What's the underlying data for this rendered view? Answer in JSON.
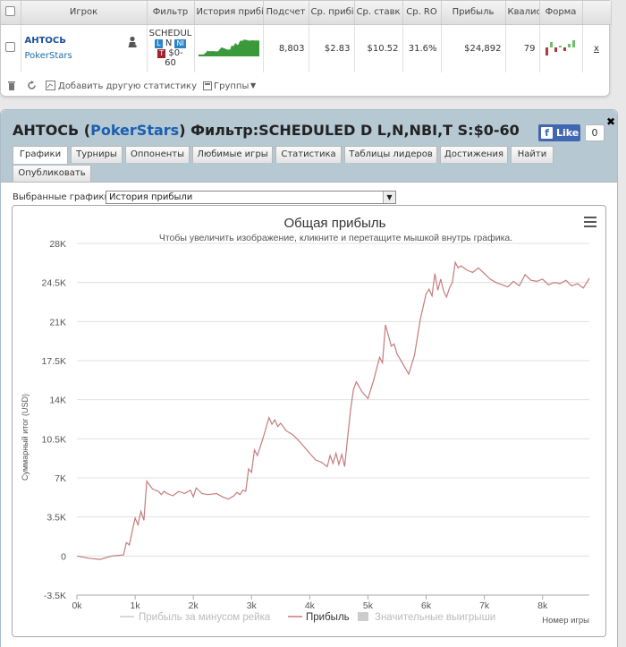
{
  "table": {
    "headers": [
      "Игрок",
      "Фильтр",
      "История прибі",
      "Подсчет",
      "Ср. прибі",
      "Ср. ставк",
      "Ср. RO",
      "Прибыль",
      "Квалис",
      "Форма"
    ],
    "row": {
      "player": "АНТОСЬ",
      "site": "PokerStars",
      "filter_line1": "SCHEDUL",
      "filter_tag_blue_1": "L",
      "filter_letter": "N",
      "filter_tag_blue_2": "NI",
      "filter_tag_red": "T",
      "filter_amount": "$0-",
      "filter_amount2": "60",
      "count": "8,803",
      "avg_profit": "$2.83",
      "avg_stake": "$10.52",
      "avg_roi": "31.6%",
      "profit": "$24,892",
      "ability": "79",
      "remove": "x"
    }
  },
  "toolbar": {
    "add_stats": "Добавить другую статистику",
    "groups": "Группы"
  },
  "panel": {
    "title_player": "АНТОСЬ",
    "title_site": "PokerStars",
    "title_filter": "Фильтр:SCHEDULED D L,N,NBI,T S:$0-60",
    "fb_like": "Like",
    "fb_count": "0"
  },
  "tabs": [
    "Графики",
    "Турниры",
    "Оппоненты",
    "Любимые игры",
    "Статистика",
    "Таблицы лидеров",
    "Достижения",
    "Найти",
    "Опубликовать"
  ],
  "graph_select": {
    "label": "Выбранные графики:",
    "value": "История прибыли"
  },
  "colors": {
    "profit_line": "#c47c7c",
    "sparkline": "#3a9a3a",
    "tab_bar": "#b6c8d2"
  },
  "chart_data": {
    "type": "line",
    "title": "Общая прибыль",
    "subtitle": "Чтобы увеличить изображение, кликните и перетащите мышкой внутрь графика.",
    "ylabel": "Суммарный итог (USD)",
    "xlabel": "Номер игры",
    "xlim": [
      0,
      8803
    ],
    "ylim": [
      -3500,
      28000
    ],
    "x_ticks": [
      "0k",
      "1k",
      "2k",
      "3k",
      "4k",
      "5k",
      "6k",
      "7k",
      "8k"
    ],
    "y_ticks": [
      "-3.5K",
      "0",
      "3.5K",
      "7K",
      "10.5K",
      "14K",
      "17.5K",
      "21K",
      "24.5K",
      "28K"
    ],
    "grid": "horizontal",
    "legend": "bottom-center",
    "legend_items": [
      "Прибыль за минусом рейка",
      "Прибыль",
      "Значительные выигрыши"
    ],
    "series": [
      {
        "name": "Прибыль",
        "x": [
          0,
          200,
          400,
          600,
          800,
          850,
          900,
          1000,
          1050,
          1100,
          1150,
          1200,
          1300,
          1400,
          1450,
          1500,
          1550,
          1650,
          1750,
          1850,
          1950,
          2000,
          2050,
          2150,
          2250,
          2400,
          2500,
          2600,
          2700,
          2750,
          2800,
          2850,
          2900,
          2950,
          3000,
          3050,
          3100,
          3200,
          3300,
          3350,
          3400,
          3450,
          3500,
          3600,
          3700,
          3800,
          3900,
          4000,
          4100,
          4200,
          4300,
          4350,
          4400,
          4450,
          4500,
          4550,
          4600,
          4650,
          4700,
          4750,
          4800,
          4900,
          5000,
          5100,
          5200,
          5250,
          5300,
          5350,
          5400,
          5450,
          5500,
          5600,
          5700,
          5800,
          5900,
          6000,
          6050,
          6100,
          6150,
          6200,
          6250,
          6300,
          6350,
          6400,
          6450,
          6500,
          6550,
          6600,
          6700,
          6800,
          6900,
          7000,
          7100,
          7200,
          7300,
          7400,
          7500,
          7600,
          7700,
          7800,
          7900,
          8000,
          8100,
          8200,
          8300,
          8400,
          8500,
          8600,
          8700,
          8803
        ],
        "values": [
          0,
          -200,
          -300,
          0,
          100,
          1200,
          1000,
          3400,
          2800,
          4000,
          3200,
          6700,
          6000,
          5800,
          5500,
          5800,
          5600,
          5400,
          5800,
          5600,
          5900,
          5300,
          6100,
          5600,
          5500,
          5600,
          5300,
          5100,
          5400,
          5700,
          5500,
          5900,
          5800,
          7800,
          7500,
          9500,
          9000,
          10600,
          12400,
          11800,
          12200,
          11600,
          11900,
          11200,
          10900,
          10400,
          9800,
          9200,
          8600,
          8400,
          8000,
          9000,
          8300,
          9200,
          8200,
          9100,
          8000,
          10600,
          13000,
          14900,
          15600,
          14700,
          14100,
          15800,
          17800,
          17300,
          20700,
          19800,
          18800,
          19000,
          18100,
          17200,
          16300,
          18000,
          21200,
          23500,
          23900,
          23300,
          25300,
          23800,
          24800,
          23700,
          23200,
          24000,
          24500,
          26300,
          25800,
          26000,
          25600,
          25400,
          25800,
          25300,
          24800,
          24500,
          24300,
          24100,
          24600,
          24200,
          25200,
          24700,
          24600,
          24800,
          24300,
          24500,
          24400,
          24700,
          24200,
          24400,
          24000,
          24892
        ]
      }
    ]
  }
}
